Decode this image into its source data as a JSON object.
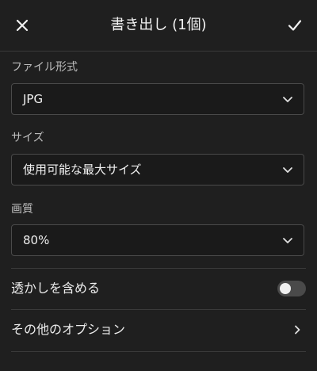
{
  "header": {
    "title": "書き出し (1個)",
    "close_icon": "close-icon",
    "confirm_icon": "checkmark-icon"
  },
  "file_format": {
    "label": "ファイル形式",
    "selected": "JPG"
  },
  "size": {
    "label": "サイズ",
    "selected": "使用可能な最大サイズ"
  },
  "quality": {
    "label": "画質",
    "selected": "80%"
  },
  "watermark": {
    "label": "透かしを含める",
    "enabled": false
  },
  "other_options": {
    "label": "その他のオプション"
  },
  "colors": {
    "background": "#1f1f1f",
    "divider": "#3a3a3a",
    "toggle_off": "#4a4a4a"
  }
}
